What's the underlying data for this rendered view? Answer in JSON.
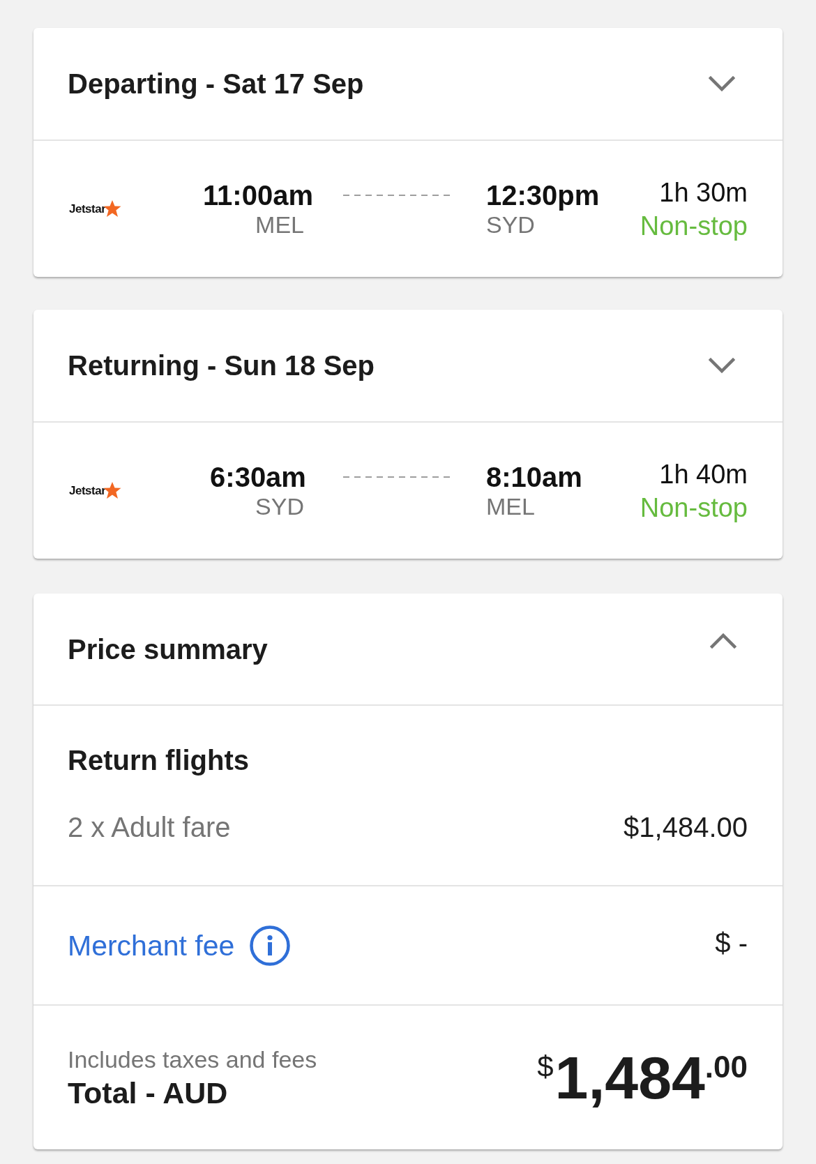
{
  "flights": [
    {
      "title": "Departing - Sat 17 Sep",
      "expanded": false,
      "airline": "Jetstar",
      "departure": {
        "time": "11:00am",
        "airport": "MEL"
      },
      "arrival": {
        "time": "12:30pm",
        "airport": "SYD"
      },
      "duration": "1h 30m",
      "stops": "Non-stop"
    },
    {
      "title": "Returning - Sun 18 Sep",
      "expanded": false,
      "airline": "Jetstar",
      "departure": {
        "time": "6:30am",
        "airport": "SYD"
      },
      "arrival": {
        "time": "8:10am",
        "airport": "MEL"
      },
      "duration": "1h 40m",
      "stops": "Non-stop"
    }
  ],
  "price_summary": {
    "title": "Price summary",
    "expanded": true,
    "section_title": "Return flights",
    "fare_lines": [
      {
        "label": "2 x Adult fare",
        "amount": "$1,484.00"
      }
    ],
    "merchant_fee": {
      "label": "Merchant fee",
      "amount": "$ -"
    },
    "total": {
      "note": "Includes taxes and fees",
      "label": "Total - AUD",
      "currency": "$",
      "amount": "1,484",
      "cents": ".00"
    }
  }
}
